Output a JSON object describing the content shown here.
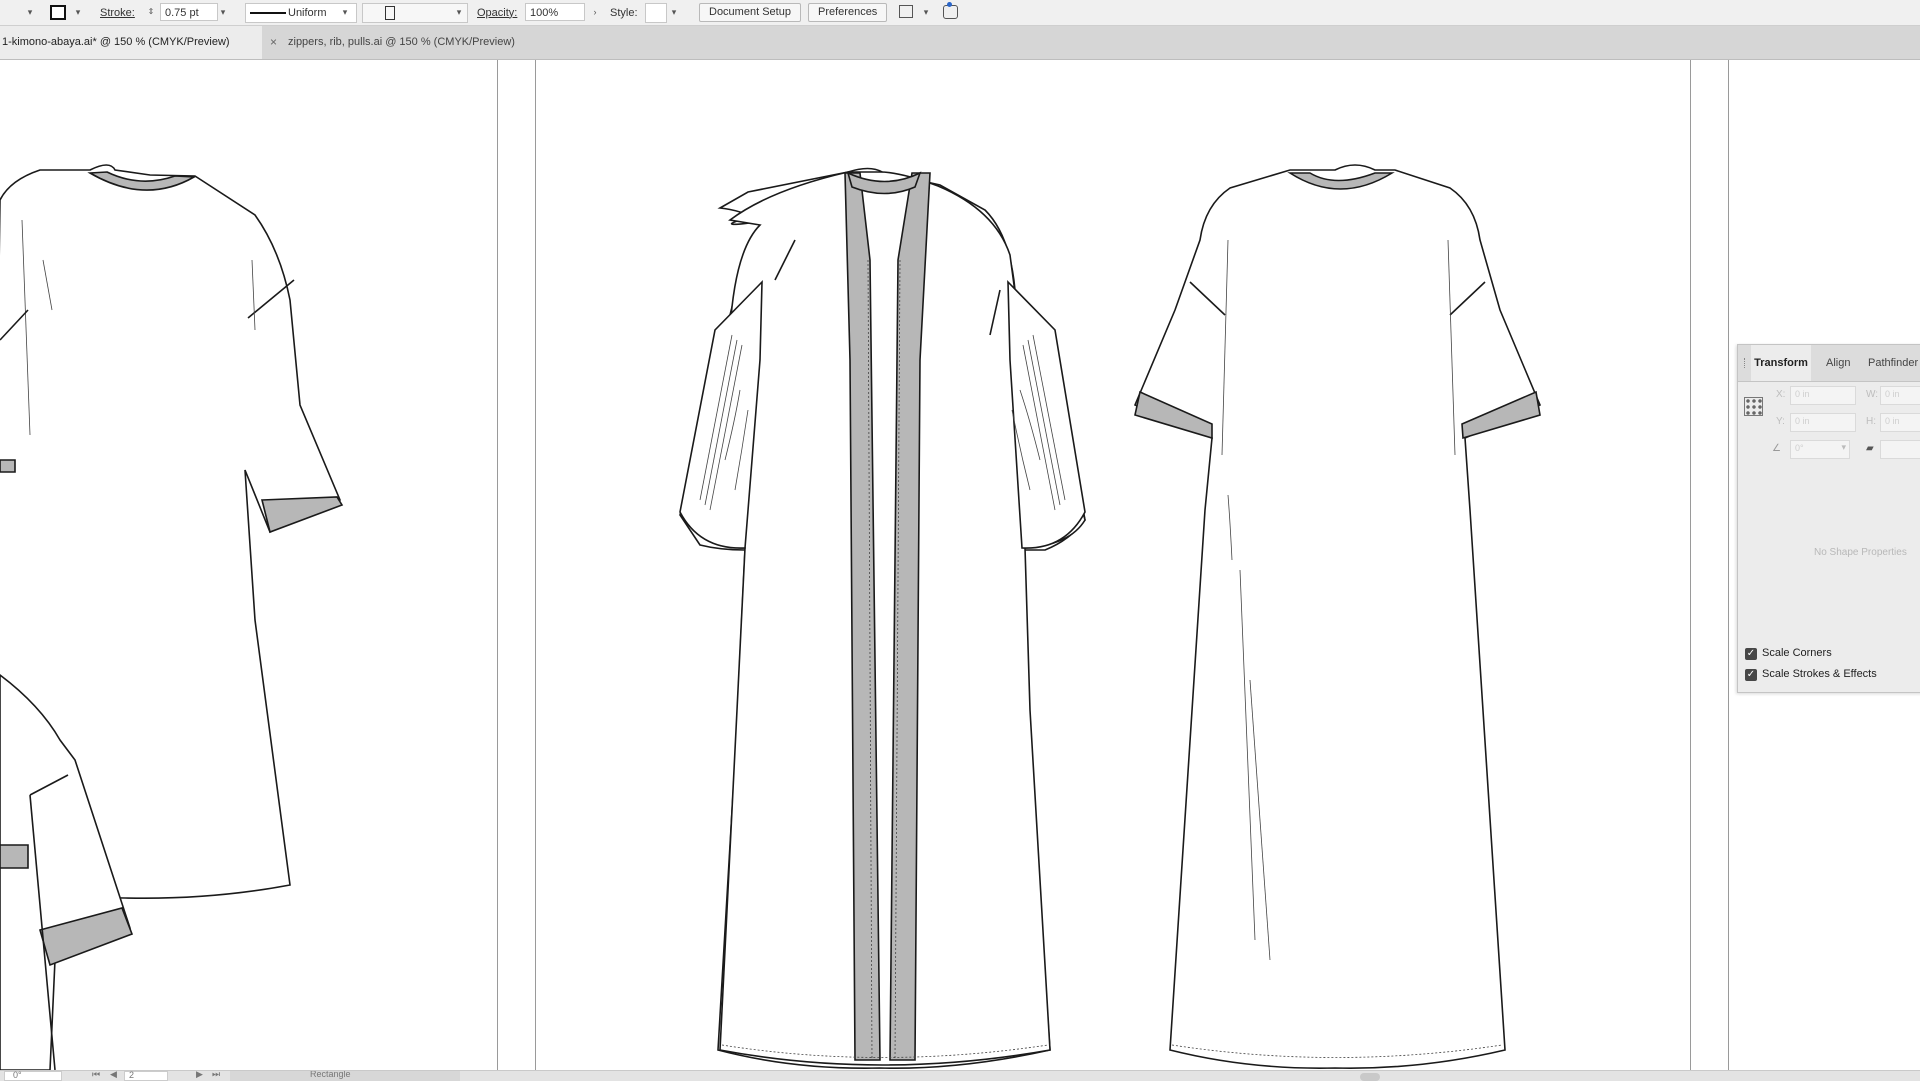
{
  "control_bar": {
    "stroke_label": "Stroke:",
    "stroke_value": "0.75 pt",
    "profile_label": "Uniform",
    "opacity_label": "Opacity:",
    "opacity_value": "100%",
    "style_label": "Style:",
    "document_setup_button": "Document Setup",
    "preferences_button": "Preferences"
  },
  "tabs": [
    {
      "label": "1-kimono-abaya.ai* @ 150 % (CMYK/Preview)",
      "active": true
    },
    {
      "label": "zippers, rib, pulls.ai @ 150 % (CMYK/Preview)",
      "active": false
    }
  ],
  "tab_close_glyph": "×",
  "transform_panel": {
    "tabs": [
      "Transform",
      "Align",
      "Pathfinder"
    ],
    "x_label": "X:",
    "y_label": "Y:",
    "w_label": "W:",
    "h_label": "H:",
    "x_value": "0 in",
    "y_value": "0 in",
    "w_value": "0 in",
    "h_value": "0 in",
    "angle_value": "0°",
    "no_shape_text": "No Shape Properties",
    "scale_corners": "Scale Corners",
    "scale_strokes": "Scale Strokes & Effects",
    "scale_corners_checked": true,
    "scale_strokes_checked": true
  },
  "status_bar": {
    "zoom_value": "0°",
    "artboard_value": "2",
    "tool_label": "Rectangle"
  },
  "colors": {
    "trim_gray": "#b7b7b7",
    "line": "#1a1a1a",
    "canvas": "#ffffff"
  }
}
